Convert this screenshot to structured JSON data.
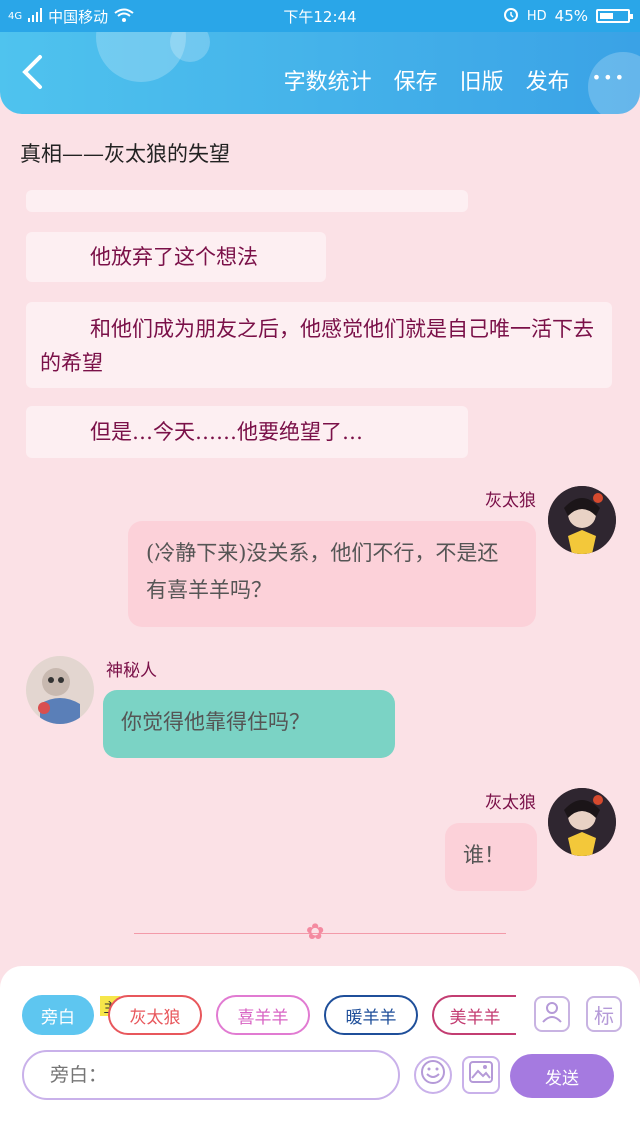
{
  "status_bar": {
    "network": "4G",
    "carrier": "中国移动",
    "time": "下午12:44",
    "hd": "HD",
    "battery": "45%"
  },
  "header": {
    "actions": [
      "字数统计",
      "保存",
      "旧版",
      "发布"
    ],
    "more": "•••"
  },
  "story_title": "真相——灰太狼的失望",
  "narration": [
    "他放弃了这个想法",
    "和他们成为朋友之后，他感觉他们就是自己唯一活下去的希望",
    "但是…今天……他要绝望了…"
  ],
  "messages": [
    {
      "sender": "灰太狼",
      "text": "(冷静下来)没关系，他们不行，不是还有喜羊羊吗？"
    },
    {
      "sender": "神秘人",
      "text": "你觉得他靠得住吗？"
    },
    {
      "sender": "灰太狼",
      "text": "谁！"
    }
  ],
  "toolbar": {
    "narrator_label": "旁白",
    "main_tag": "主",
    "characters": [
      "灰太狼",
      "喜羊羊",
      "暖羊羊",
      "美羊羊"
    ],
    "tag_button": "标",
    "input_placeholder": "旁白：",
    "send_label": "发送"
  },
  "colors": {
    "header": "#3aa7e8",
    "background": "#fbe1e6",
    "bubble_right": "#fcd1d9",
    "bubble_left": "#7bd3c5",
    "send": "#a57ae0"
  }
}
